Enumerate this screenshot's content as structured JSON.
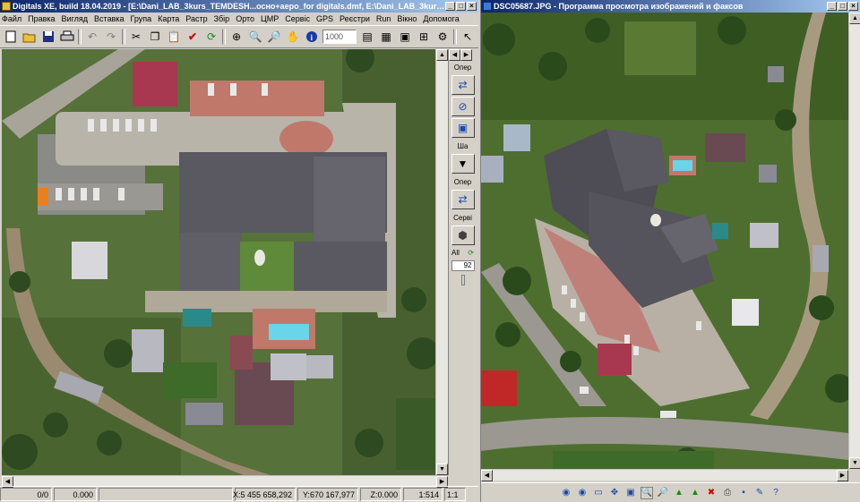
{
  "left": {
    "title": "Digitals XE, build 18.04.2019 - [E:\\Dani_LAB_3kurs_TEMDESH...осно+аеро_for digitals.dmf, E:\\Dani_LAB_3kurs_TEMDESH-TOP...",
    "menu": [
      "Файл",
      "Правка",
      "Вигляд",
      "Вставка",
      "Група",
      "Карта",
      "Растр",
      "Збір",
      "Орто",
      "ЦМР",
      "Сервіс",
      "GPS",
      "Реєстри",
      "Run",
      "Вікно",
      "Допомога"
    ],
    "scale_value": "1000",
    "side_labels": {
      "oper": "Опер",
      "shar": "Ша",
      "oper2": "Опер",
      "servis": "Серві",
      "all": "All"
    },
    "zoom_value": "92",
    "status": {
      "a": "0/0",
      "b": "0.000",
      "x": "X:5 455 658,292",
      "y": "Y:670 167,977",
      "z": "Z:0.000",
      "scale": "1:514",
      "ratio": "1:1"
    }
  },
  "right": {
    "title": "DSC05687.JPG - Программа просмотра изображений и факсов"
  },
  "icons": {
    "new": "new-doc-icon",
    "open": "open-folder-icon",
    "save": "save-icon",
    "print": "print-icon"
  },
  "colors": {
    "title_start": "#0a246a",
    "title_end": "#a6caf0",
    "chrome": "#d4d0c8"
  }
}
